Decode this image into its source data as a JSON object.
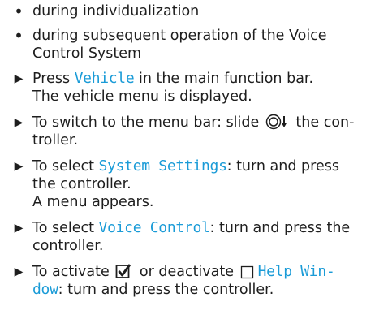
{
  "colors": {
    "text": "#1e1e1e",
    "highlight": "#1a9bd7"
  },
  "icons": {
    "bullet": "bullet-dot-icon",
    "step": "triangle-right-icon",
    "controller": "controller-slide-down-icon",
    "checked": "checkbox-checked-icon",
    "unchecked": "checkbox-unchecked-icon"
  },
  "bullets": [
    "during individualization",
    "during subsequent operation of the Voice",
    "Control System"
  ],
  "steps": {
    "s1_pre": "Press ",
    "s1_hl": "Vehicle",
    "s1_post": " in the main function bar.",
    "s1_l2": "The vehicle menu is displayed.",
    "s2_pre": "To switch to the menu bar: slide ",
    "s2_post": " the con-",
    "s2_l2": "troller.",
    "s3_pre": "To select ",
    "s3_hl": "System Settings",
    "s3_post": ": turn and press",
    "s3_l2": "the controller.",
    "s3_l3": "A menu appears.",
    "s4_pre": "To select ",
    "s4_hl": "Voice Control",
    "s4_post": ": turn and press the",
    "s4_l2": "controller.",
    "s5_pre": "To activate ",
    "s5_mid": " or deactivate ",
    "s5_hl": "Help Win-",
    "s5_l2_hl": "dow",
    "s5_l2_post": ": turn and press the controller."
  }
}
